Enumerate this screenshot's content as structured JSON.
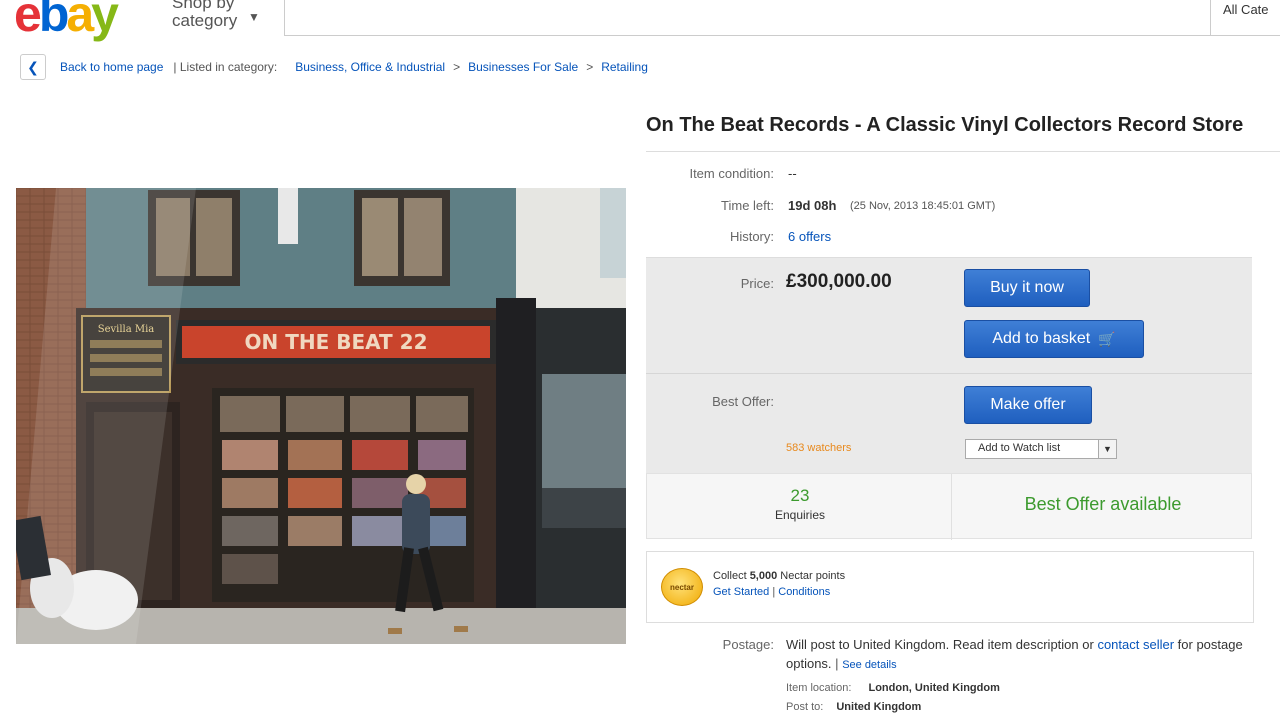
{
  "header": {
    "logo_letters": [
      {
        "ch": "e",
        "color": "#e53238"
      },
      {
        "ch": "b",
        "color": "#0064d2"
      },
      {
        "ch": "a",
        "color": "#f5af02"
      },
      {
        "ch": "y",
        "color": "#86b817"
      }
    ],
    "shop_by_line1": "Shop by",
    "shop_by_line2": "category",
    "search_placeholder": "",
    "category_select": "All Cate"
  },
  "breadcrumb": {
    "back": "Back to home page",
    "listed_in": "| Listed in category:",
    "crumbs": [
      "Business, Office & Industrial",
      "Businesses For Sale",
      "Retailing"
    ],
    "sep": ">"
  },
  "photo": {
    "sign_left_line1": "Sevilla Mia",
    "sign_main": "ON THE BEAT 22"
  },
  "listing": {
    "title": "On The Beat Records - A Classic Vinyl Collectors Record Store",
    "condition_label": "Item condition:",
    "condition_value": "--",
    "time_left_label": "Time left:",
    "time_left_value": "19d 08h",
    "time_left_detail": "(25 Nov, 2013 18:45:01 GMT)",
    "history_label": "History:",
    "history_value": "6 offers",
    "price_label": "Price:",
    "price_value": "£300,000.00",
    "buy_now": "Buy it now",
    "add_basket": "Add to basket",
    "best_offer_label": "Best Offer:",
    "make_offer": "Make offer",
    "watchers": "583 watchers",
    "watch_list": "Add to Watch list",
    "enquiries_count": "23",
    "enquiries_label": "Enquiries",
    "best_offer_available": "Best Offer available",
    "nectar_badge": "nectar",
    "nectar_collect": "Collect",
    "nectar_points": "5,000",
    "nectar_tail": "Nectar points",
    "get_started": "Get Started",
    "conditions": "Conditions",
    "postage_label": "Postage:",
    "postage_text1": "Will post to United Kingdom. Read item description or",
    "contact_seller": "contact seller",
    "postage_text2": "for postage options.",
    "see_details": "See details",
    "item_location_label": "Item location:",
    "item_location_value": "London, United Kingdom",
    "post_to_label": "Post to:",
    "post_to_value": "United Kingdom"
  },
  "colors": {
    "link": "#0654ba",
    "button": "#1f5fbf",
    "watchers": "#e8891d",
    "enquiries": "#3c9a2e",
    "best_offer_available": "#3c9a2e"
  }
}
